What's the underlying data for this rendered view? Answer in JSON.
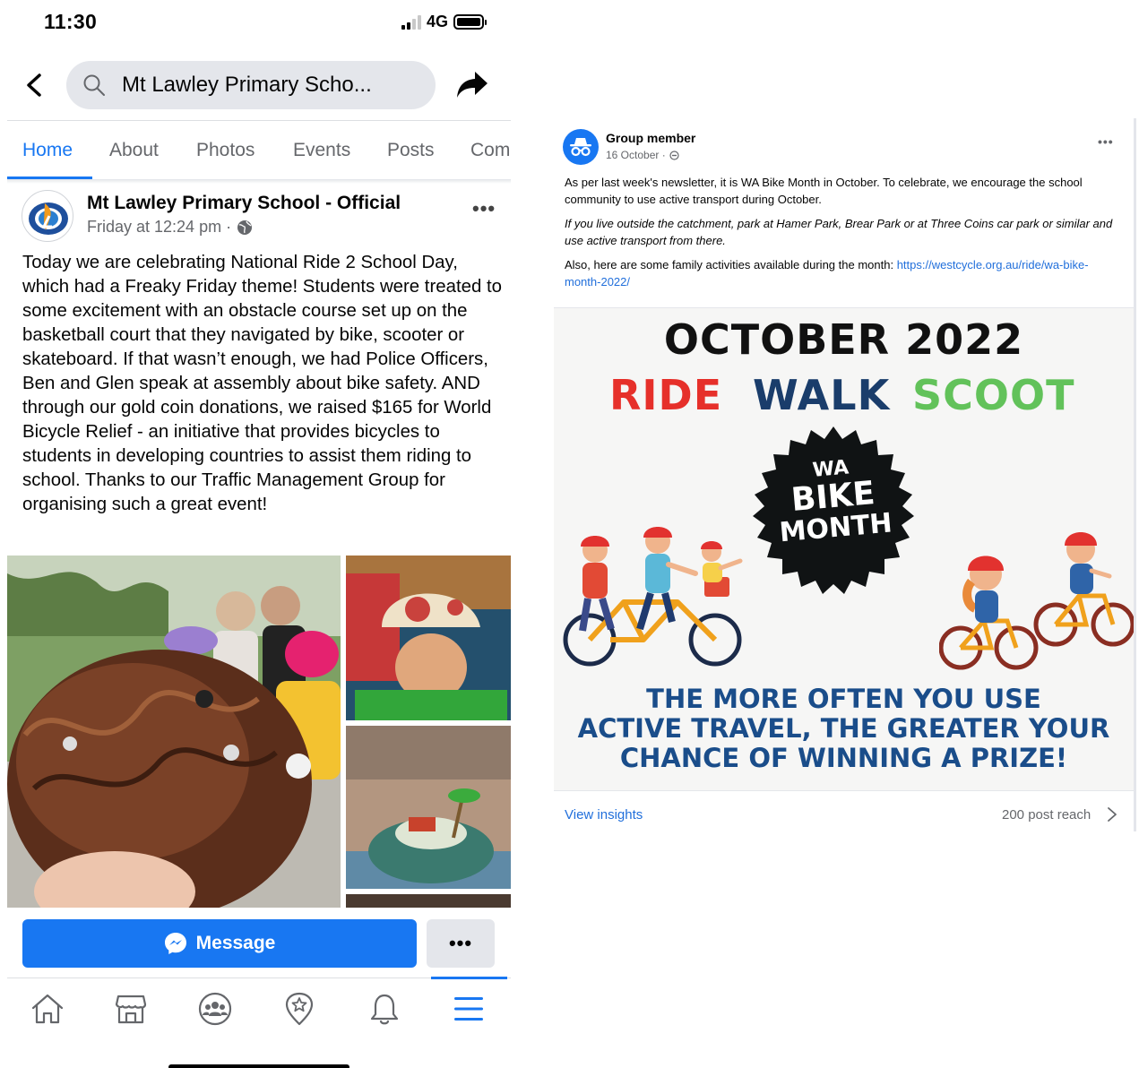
{
  "status": {
    "time": "11:30",
    "network": "4G"
  },
  "topbar": {
    "search_value": "Mt Lawley Primary Scho..."
  },
  "tabs": [
    {
      "label": "Home",
      "active": true
    },
    {
      "label": "About"
    },
    {
      "label": "Photos"
    },
    {
      "label": "Events"
    },
    {
      "label": "Posts"
    },
    {
      "label": "Com"
    }
  ],
  "post": {
    "author": "Mt Lawley Primary School - Official",
    "timestamp": "Friday at 12:24 pm · ",
    "more": "•••",
    "text": "Today we are celebrating National Ride 2 School Day, which had a Freaky Friday theme! Students were treated to some excitement with an obstacle course set up on the basketball court that they navigated by bike, scooter or skateboard. If that wasn’t enough, we had Police Officers, Ben and Glen speak at assembly about bike safety. AND through our gold coin donations, we raised $165 for World Bicycle Relief - an initiative that provides bicycles to students in developing countries to assist them riding to school. Thanks to our Traffic Management Group for organising such a great event!"
  },
  "actions": {
    "message_label": "Message",
    "more_label": "•••"
  },
  "bottom_nav": [
    "home-icon",
    "marketplace-icon",
    "groups-icon",
    "pages-icon",
    "notifications-icon",
    "menu-icon"
  ],
  "card": {
    "author": "Group member",
    "date": "16 October · ",
    "more": "•••",
    "para1": "As per last week's newsletter, it is WA Bike Month in October. To celebrate, we encourage the school community to use active transport during October.",
    "para2": "If you live outside the catchment, park at Hamer Park, Brear Park or at Three Coins car park or similar and use active transport from there.",
    "para3_prefix": "Also, here are some family activities available during the month: ",
    "para3_link": "https://westcycle.org.au/ride/wa-bike-month-2022/",
    "flyer": {
      "title": "OCTOBER 2022",
      "word1": "RIDE",
      "word2": "WALK",
      "word3": "SCOOT",
      "badge_line1": "WA",
      "badge_line2": "BIKE",
      "badge_line3": "MONTH",
      "slogan1": "THE MORE OFTEN YOU USE",
      "slogan2": "ACTIVE TRAVEL, THE GREATER YOUR",
      "slogan3": "CHANCE OF WINNING A PRIZE!"
    },
    "insights_label": "View insights",
    "reach": "200 post reach"
  },
  "colors": {
    "accent": "#1877f2",
    "ride": "#e6302a",
    "walk": "#1a3d6b",
    "scoot": "#62c25a",
    "slogan": "#1a4d8a"
  }
}
